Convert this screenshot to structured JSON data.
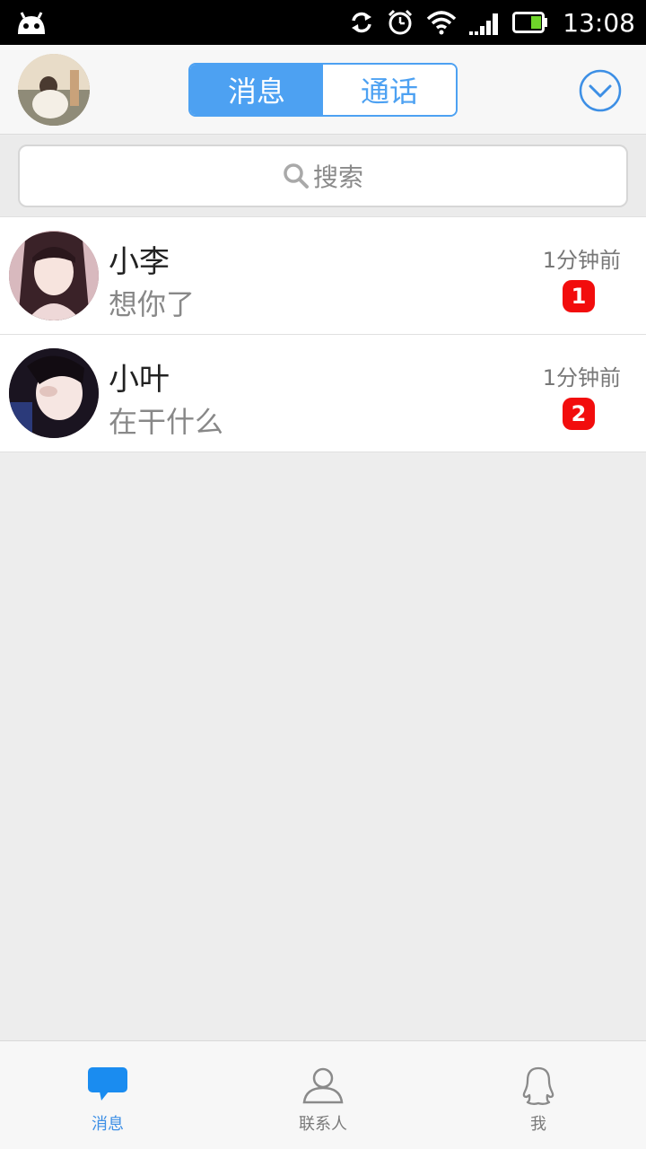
{
  "status_bar": {
    "time": "13:08",
    "icons": [
      "android-robot-icon",
      "sync-icon",
      "alarm-icon",
      "wifi-icon",
      "signal-icon",
      "battery-icon"
    ]
  },
  "header": {
    "tabs": [
      {
        "label": "消息",
        "active": true
      },
      {
        "label": "通话",
        "active": false
      }
    ],
    "dropdown_icon": "chevron-down-circle-icon"
  },
  "search": {
    "placeholder": "搜索",
    "icon": "search-icon"
  },
  "conversations": [
    {
      "name": "小李",
      "preview": "想你了",
      "time": "1分钟前",
      "unread": "1"
    },
    {
      "name": "小叶",
      "preview": "在干什么",
      "time": "1分钟前",
      "unread": "2"
    }
  ],
  "bottom_nav": [
    {
      "label": "消息",
      "icon": "chat-bubble-icon",
      "active": true
    },
    {
      "label": "联系人",
      "icon": "contact-person-icon",
      "active": false
    },
    {
      "label": "我",
      "icon": "penguin-icon",
      "active": false
    }
  ],
  "colors": {
    "accent": "#4da1f2",
    "badge": "#f20d0d",
    "status_bar": "#000000"
  }
}
